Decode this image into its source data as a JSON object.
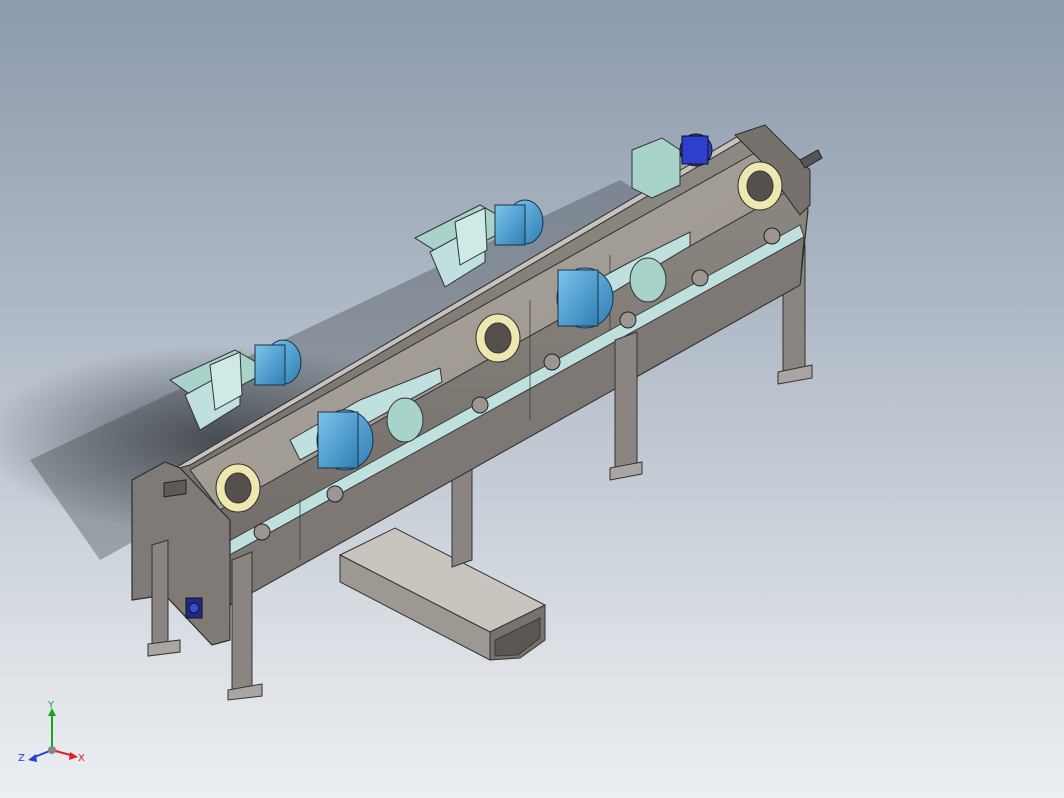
{
  "viewport": {
    "background_top": "#8d9aac",
    "background_bottom": "#eceff2"
  },
  "model": {
    "body_color": "#8a8580",
    "panel_color": "#a9a39d",
    "rail_color": "#bfe0de",
    "motor_color": "#4fa7d6",
    "drive_motor_color": "#2d3fcf",
    "hopper_color": "#a8d3cb",
    "porthole_ring_color": "#efe7b0"
  },
  "triad": {
    "x_label": "X",
    "y_label": "Y",
    "z_label": "Z",
    "x_color": "#e02020",
    "y_color": "#20a020",
    "z_color": "#2040e0"
  }
}
